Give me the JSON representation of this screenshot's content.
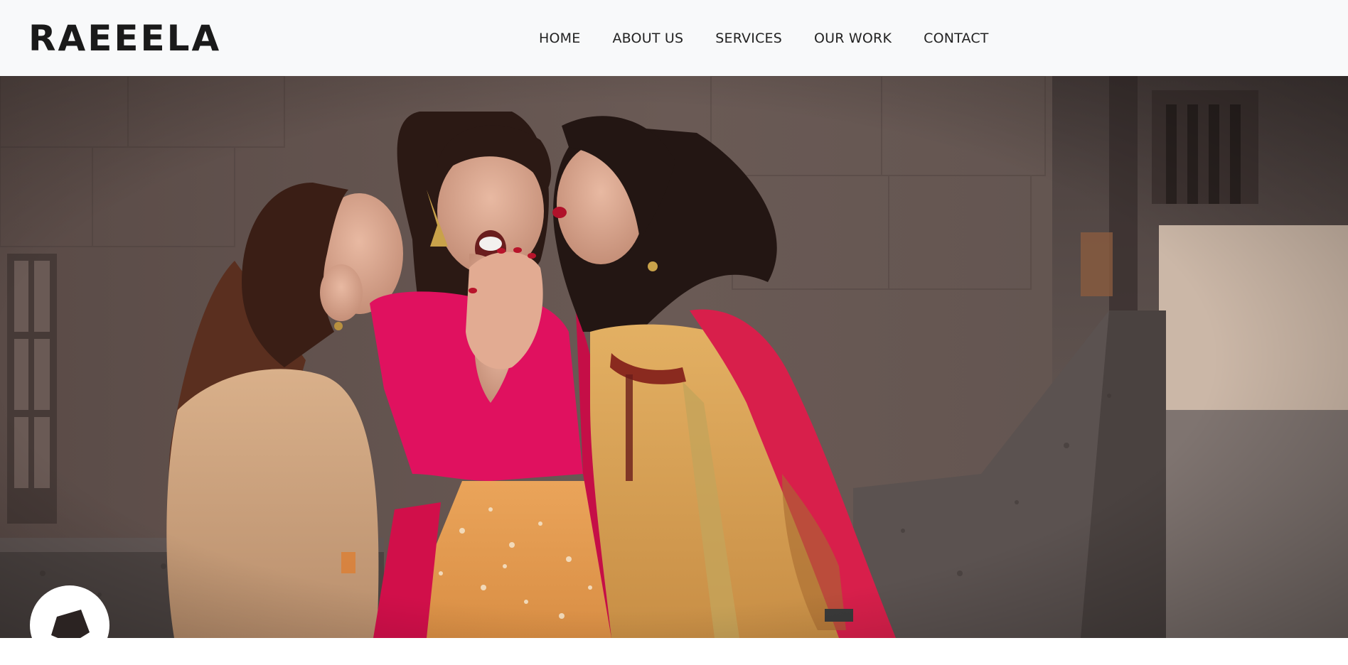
{
  "brand": {
    "logo_text": "RAEEELA"
  },
  "nav": {
    "items": [
      {
        "label": "HOME"
      },
      {
        "label": "ABOUT US"
      },
      {
        "label": "SERVICES"
      },
      {
        "label": "OUR WORK"
      },
      {
        "label": "CONTACT"
      }
    ]
  },
  "hero": {
    "image_subject": "hero-photo-three-women",
    "icon": "camera-aperture-icon"
  },
  "colors": {
    "navbar_bg": "#f8f9fa",
    "text_dark": "#1a1a1a",
    "accent_pink": "#e0115f",
    "accent_mustard": "#d9a14a"
  }
}
